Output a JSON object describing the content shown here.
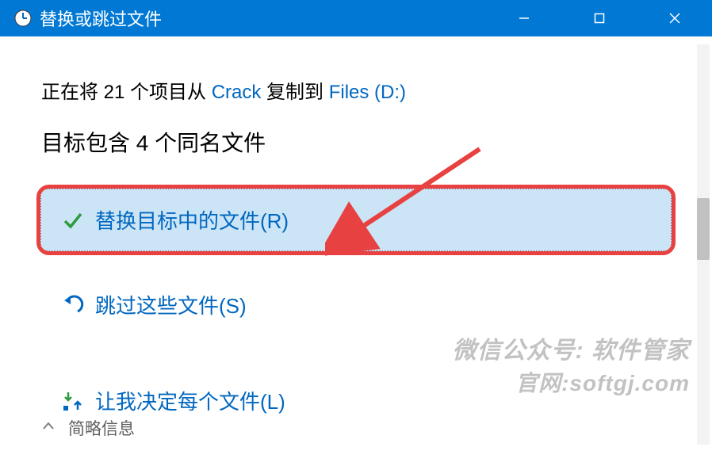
{
  "titlebar": {
    "title": "替换或跳过文件"
  },
  "copy_line": {
    "prefix": "正在将 21 个项目从 ",
    "source": "Crack",
    "mid": " 复制到 ",
    "dest": "Files (D:)"
  },
  "conflict_heading": "目标包含 4 个同名文件",
  "options": {
    "replace": "替换目标中的文件(R)",
    "skip": "跳过这些文件(S)",
    "decide": "让我决定每个文件(L)"
  },
  "details": {
    "label": "简略信息"
  },
  "watermark": {
    "line1": "微信公众号: 软件管家",
    "line2": "官网:softgj.com"
  }
}
